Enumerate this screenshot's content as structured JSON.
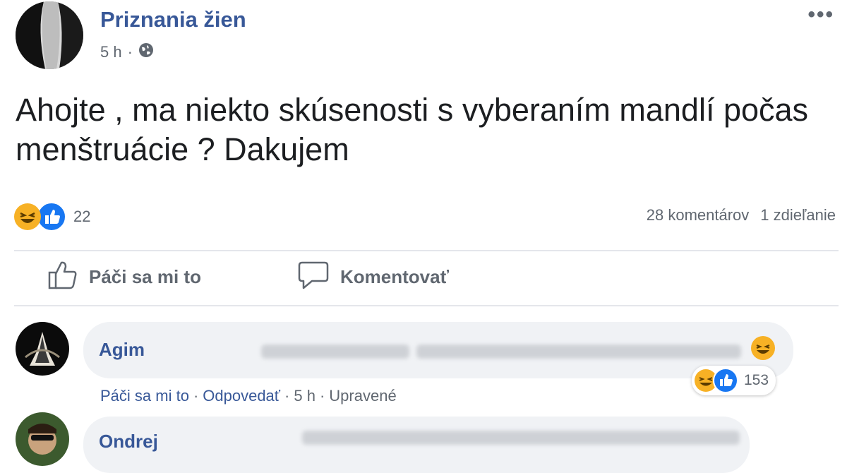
{
  "post": {
    "page_name": "Priznania žien",
    "time": "5 h",
    "text": "Ahojte , ma niekto skúsenosti s vyberaním mandlí počas menštruácie ? Dakujem",
    "reaction_count": "22",
    "comments_count": "28 komentárov",
    "shares_count": "1 zdieľanie"
  },
  "actions": {
    "like": "Páči sa mi to",
    "comment": "Komentovať"
  },
  "comments": [
    {
      "author": "Agim",
      "like": "Páči sa mi to",
      "reply": "Odpovedať",
      "time": "5 h",
      "edited": "Upravené",
      "reaction_count": "153"
    },
    {
      "author": "Ondrej"
    }
  ],
  "colors": {
    "link_blue": "#385898",
    "like_blue": "#1877f2",
    "haha_yellow": "#f7b125",
    "secondary_text": "#606770"
  },
  "icons": [
    "globe-icon",
    "more-icon",
    "haha-icon",
    "like-icon",
    "thumbs-up-icon",
    "comment-icon"
  ]
}
